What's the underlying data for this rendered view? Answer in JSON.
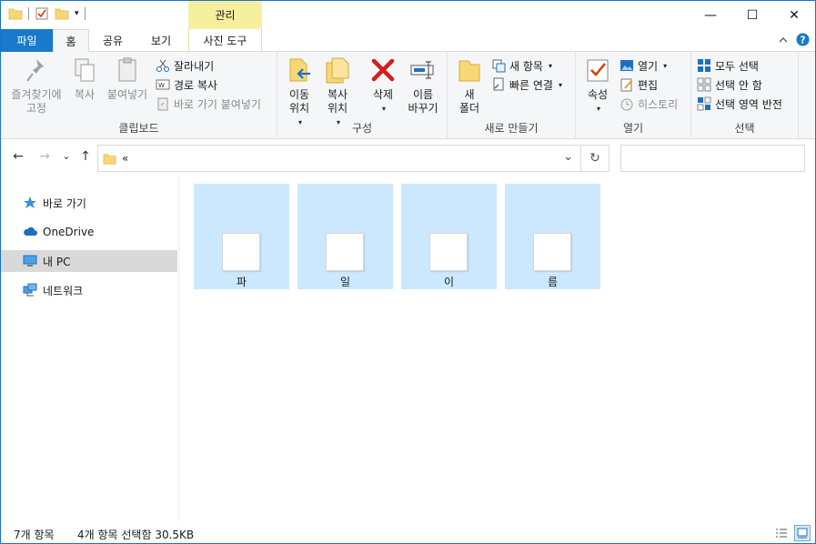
{
  "titlebar": {
    "context_tab": "관리",
    "minimize_glyph": "—",
    "maximize_glyph": "☐",
    "close_glyph": "✕"
  },
  "tabs": {
    "file": "파일",
    "home": "홈",
    "share": "공유",
    "view": "보기",
    "photo_tools": "사진 도구"
  },
  "ribbon": {
    "clipboard": {
      "label": "클립보드",
      "pin": "즐겨찾기에\n고정",
      "copy": "복사",
      "paste": "붙여넣기",
      "cut": "잘라내기",
      "copy_path": "경로 복사",
      "paste_shortcut": "바로 가기 붙여넣기"
    },
    "organize": {
      "label": "구성",
      "move_to": "이동\n위치",
      "copy_to": "복사\n위치",
      "delete": "삭제",
      "rename": "이름\n바꾸기"
    },
    "new": {
      "label": "새로 만들기",
      "new_folder": "새\n폴더",
      "new_item": "새 항목",
      "easy_access": "빠른 연결"
    },
    "open": {
      "label": "열기",
      "properties": "속성",
      "open": "열기",
      "edit": "편집",
      "history": "히스토리"
    },
    "select": {
      "label": "선택",
      "select_all": "모두 선택",
      "select_none": "선택 안 함",
      "invert": "선택 영역 반전"
    }
  },
  "address": {
    "path": "«",
    "back_glyph": "←",
    "forward_glyph": "→",
    "recent_glyph": "⌄",
    "up_glyph": "↑",
    "refresh_glyph": "↻",
    "dropdown_glyph": "⌄"
  },
  "navpane": {
    "items": [
      {
        "label": "바로 가기",
        "icon": "star-icon"
      },
      {
        "label": "OneDrive",
        "icon": "cloud-icon"
      },
      {
        "label": "내 PC",
        "icon": "pc-icon"
      },
      {
        "label": "네트워크",
        "icon": "network-icon"
      }
    ]
  },
  "files": [
    {
      "name": "파"
    },
    {
      "name": "일"
    },
    {
      "name": "이"
    },
    {
      "name": "름"
    }
  ],
  "status": {
    "count": "7개 항목",
    "selection": "4개 항목 선택함 30.5KB"
  },
  "colors": {
    "accent": "#1979ca",
    "selected_tile": "#cce8ff",
    "context_tab": "#f6ef9e"
  }
}
